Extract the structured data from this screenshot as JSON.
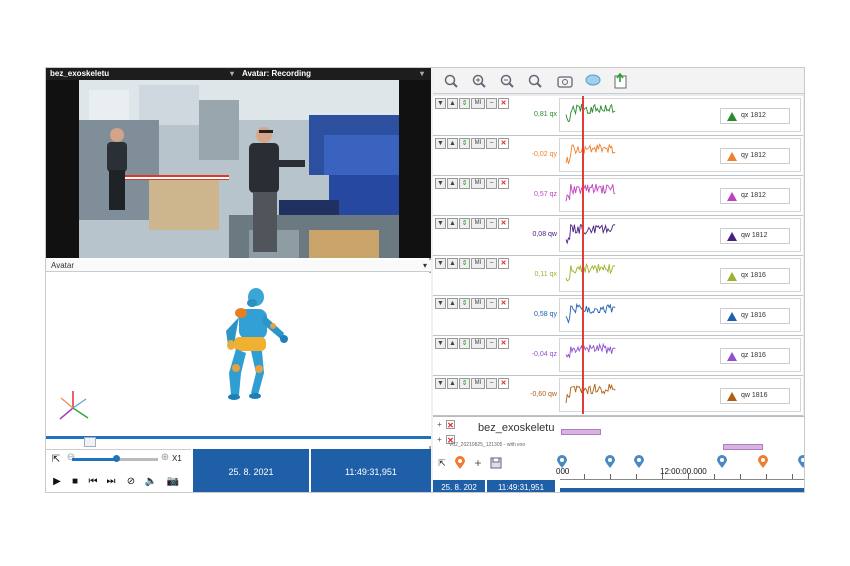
{
  "video": {
    "title_left": "bez_exoskeletu",
    "title_right": "Avatar: Recording"
  },
  "avatar": {
    "header": "Avatar",
    "dropdown_glyph": "▾"
  },
  "playback": {
    "speed": "X1",
    "date": "25. 8. 2021",
    "time": "11:49:31,951",
    "volume_level": 0.5
  },
  "toolbar": {
    "icons": [
      "zoom-fit-icon",
      "zoom-in-icon",
      "zoom-out-icon",
      "zoom-reset-icon",
      "screenshot-icon",
      "comment-icon",
      "export-icon"
    ]
  },
  "channels": [
    {
      "value": "0,81 qx",
      "label": "qx 1812",
      "color": "#2b8a2b"
    },
    {
      "value": "-0,02 qy",
      "label": "qy 1812",
      "color": "#f08030"
    },
    {
      "value": "0,57 qz",
      "label": "qz 1812",
      "color": "#c040c0"
    },
    {
      "value": "0,08 qw",
      "label": "qw 1812",
      "color": "#4a2080"
    },
    {
      "value": "0,11 qx",
      "label": "qx 1816",
      "color": "#a0b030"
    },
    {
      "value": "0,58 qy",
      "label": "qy 1816",
      "color": "#2060b0"
    },
    {
      "value": "-0,04 qz",
      "label": "qz 1816",
      "color": "#9050d0"
    },
    {
      "value": "-0,60 qw",
      "label": "qw 1816",
      "color": "#b06010"
    }
  ],
  "row_buttons": {
    "down": "▼",
    "up": "▲",
    "mi": "MI",
    "minus": "−",
    "close": "✕",
    "drag": "⇕"
  },
  "segment": {
    "title": "bez_exoskeletu",
    "subtitle": "V02_20210825_121305 - with exo",
    "plus": "+",
    "close": "✕"
  },
  "timeline": {
    "label": "12:00:00.000",
    "zero": "000",
    "date": "25. 8. 202",
    "time": "11:49:31,951"
  }
}
